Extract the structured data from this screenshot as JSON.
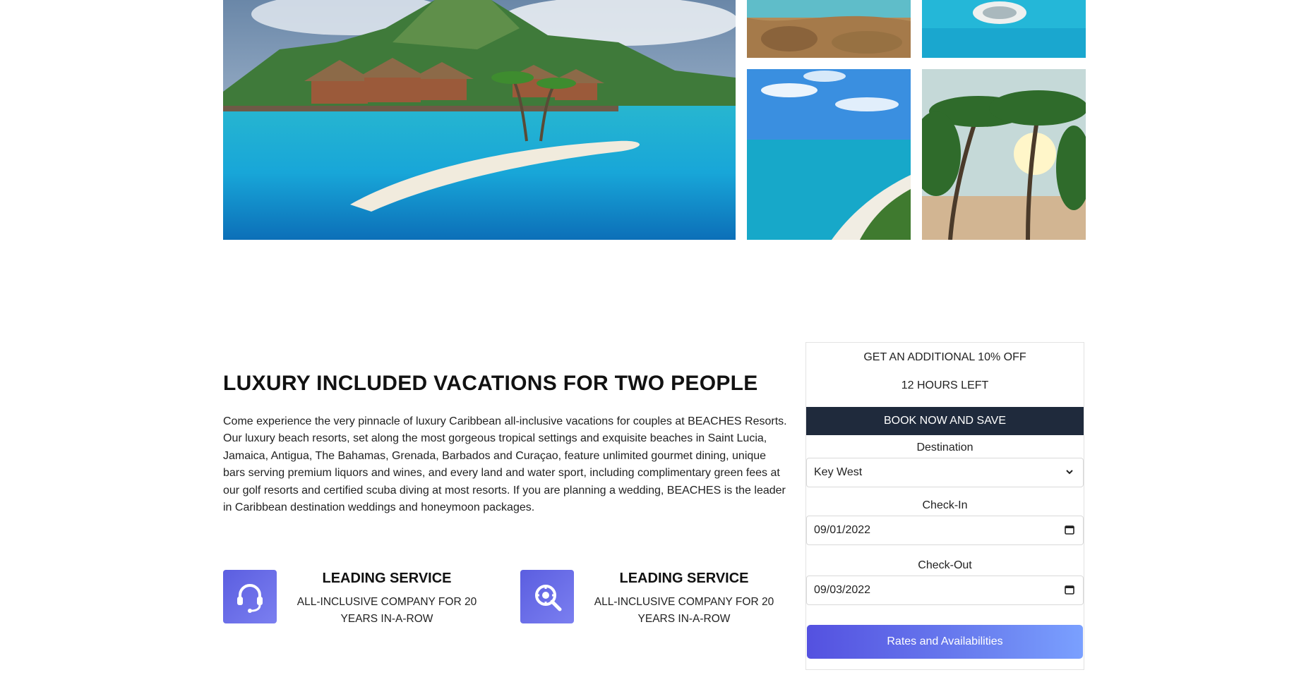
{
  "gallery": {
    "main": "overwater bungalows lagoon photo",
    "thumbs": [
      "aerial island coast photo",
      "aerial overwater resort photo",
      "tropical beach coastline photo",
      "palm trees sunset beach photo"
    ]
  },
  "intro": {
    "heading": "LUXURY INCLUDED VACATIONS FOR TWO PEOPLE",
    "paragraph": "Come experience the very pinnacle of luxury Caribbean all-inclusive vacations for couples at BEACHES Resorts. Our luxury beach resorts, set along the most gorgeous tropical settings and exquisite beaches in Saint Lucia, Jamaica, Antigua, The Bahamas, Grenada, Barbados and Curaçao, feature unlimited gourmet dining, unique bars serving premium liquors and wines, and every land and water sport, including complimentary green fees at our golf resorts and certified scuba diving at most resorts. If you are planning a wedding, BEACHES is the leader in Caribbean destination weddings and honeymoon packages."
  },
  "features": [
    {
      "icon": "headset-icon",
      "title": "LEADING SERVICE",
      "desc": "ALL-INCLUSIVE COMPANY FOR 20 YEARS IN-A-ROW"
    },
    {
      "icon": "search-gear-icon",
      "title": "LEADING SERVICE",
      "desc": "ALL-INCLUSIVE COMPANY FOR 20 YEARS IN-A-ROW"
    }
  ],
  "booking": {
    "promo": "GET AN ADDITIONAL 10% OFF",
    "time_left": "12 HOURS LEFT",
    "cta_bar": "BOOK NOW AND SAVE",
    "destination_label": "Destination",
    "destination_value": "Key West",
    "checkin_label": "Check-In",
    "checkin_value": "09/01/2022",
    "checkout_label": "Check-Out",
    "checkout_value": "09/03/2022",
    "submit": "Rates and Availabilities"
  },
  "colors": {
    "accent": "#5b5ee0",
    "dark_bar": "#1f2a3c",
    "button_start": "#5451e0",
    "button_end": "#7aa0ff"
  }
}
